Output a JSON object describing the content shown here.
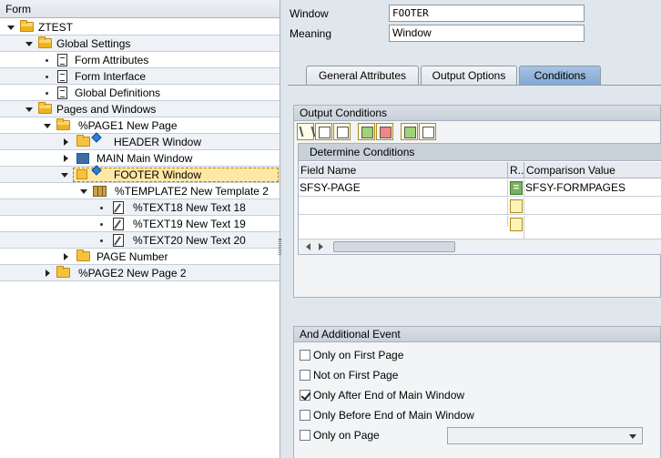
{
  "tree": {
    "header": "Form",
    "nodes": [
      {
        "label": "ZTEST"
      },
      {
        "label": "Global Settings"
      },
      {
        "label": "Form Attributes"
      },
      {
        "label": "Form Interface"
      },
      {
        "label": "Global Definitions"
      },
      {
        "label": "Pages and Windows"
      },
      {
        "label": "%PAGE1 New Page"
      },
      {
        "label": "HEADER Window"
      },
      {
        "label": "MAIN Main Window"
      },
      {
        "label": "FOOTER Window"
      },
      {
        "label": "%TEMPLATE2 New Template 2"
      },
      {
        "label": "%TEXT18 New Text 18"
      },
      {
        "label": "%TEXT19 New Text 19"
      },
      {
        "label": "%TEXT20 New Text 20"
      },
      {
        "label": "PAGE Number"
      },
      {
        "label": "%PAGE2 New Page 2"
      }
    ]
  },
  "header_fields": {
    "window_label": "Window",
    "window_value": "FOOTER",
    "meaning_label": "Meaning",
    "meaning_value": "Window"
  },
  "tabs": [
    {
      "label": "General Attributes"
    },
    {
      "label": "Output Options"
    },
    {
      "label": "Conditions"
    }
  ],
  "output_conditions": {
    "title": "Output Conditions",
    "subtitle": "Determine Conditions",
    "columns": [
      "Field Name",
      "R...",
      "Comparison Value"
    ],
    "rows": [
      {
        "field": "SFSY-PAGE",
        "relation": "=",
        "value": "SFSY-FORMPAGES"
      },
      {
        "field": "",
        "relation": "",
        "value": ""
      },
      {
        "field": "",
        "relation": "",
        "value": ""
      },
      {
        "field": "",
        "relation": "",
        "value": ""
      },
      {
        "field": "",
        "relation": "",
        "value": ""
      }
    ]
  },
  "additional_event": {
    "title": "And Additional Event",
    "options": [
      {
        "label": "Only on First Page",
        "checked": false
      },
      {
        "label": "Not on First Page",
        "checked": false
      },
      {
        "label": "Only After End of Main Window",
        "checked": true
      },
      {
        "label": "Only Before End of Main Window",
        "checked": false
      },
      {
        "label": "Only on Page",
        "checked": false
      }
    ],
    "page_select_value": ""
  },
  "colors": {
    "active_tab": "#7fa6cf",
    "selection": "#ffe8a6",
    "folder": "#f7c23b"
  }
}
